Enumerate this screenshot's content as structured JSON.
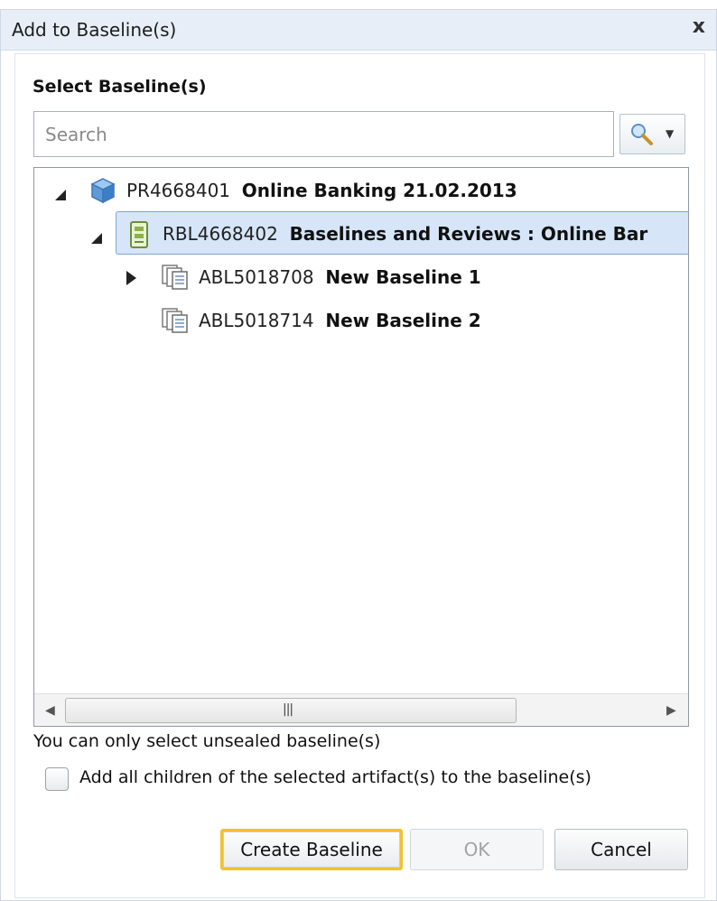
{
  "dialog": {
    "title": "Add to Baseline(s)",
    "close_label": "x"
  },
  "section": {
    "label": "Select Baseline(s)"
  },
  "search": {
    "placeholder": "Search",
    "value": "",
    "button_icon": "magnifier-icon"
  },
  "tree": {
    "nodes": [
      {
        "id": "PR4668401",
        "name": "Online Banking 21.02.2013",
        "icon": "project-cube-icon",
        "expanded": true,
        "level": 0
      },
      {
        "id": "RBL4668402",
        "name": "Baselines and Reviews : Online Bar",
        "icon": "baseline-folder-icon",
        "expanded": true,
        "selected": true,
        "level": 1
      },
      {
        "id": "ABL5018708",
        "name": "New Baseline 1",
        "icon": "baseline-doc-icon",
        "expanded": false,
        "level": 2
      },
      {
        "id": "ABL5018714",
        "name": "New Baseline 2",
        "icon": "baseline-doc-icon",
        "level": 2
      }
    ],
    "scroll_grip": "|||"
  },
  "hint": "You can only select unsealed baseline(s)",
  "option": {
    "label": "Add all children of the selected artifact(s) to the baseline(s)",
    "checked": false
  },
  "buttons": {
    "create": "Create Baseline",
    "ok": "OK",
    "cancel": "Cancel"
  },
  "colors": {
    "titlebar": "#e7eef7",
    "selection": "#d6e6f8",
    "focus_outline": "#f2c12e"
  }
}
